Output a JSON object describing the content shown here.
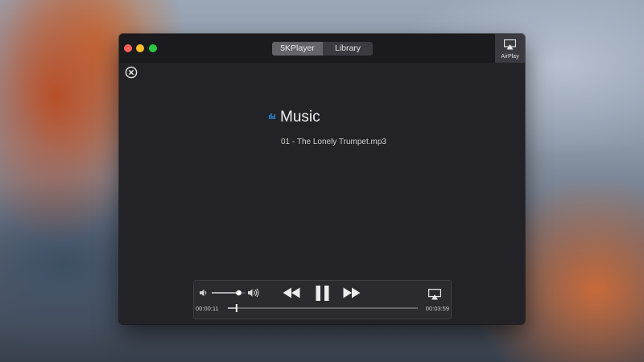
{
  "window": {
    "tabs": [
      {
        "label": "5KPlayer",
        "active": true
      },
      {
        "label": "Library",
        "active": false
      }
    ],
    "airplay_label": "AirPlay"
  },
  "content": {
    "section_title": "Music",
    "tracks": [
      "01 - The Lonely Trumpet.mp3"
    ]
  },
  "player": {
    "elapsed": "00:00:11",
    "duration": "00:03:59",
    "progress_fraction": 0.046,
    "volume_fraction": 0.8,
    "state": "playing"
  },
  "icons": {
    "close": "close-circle-icon",
    "equalizer": "equalizer-icon",
    "volume_low": "speaker-low-icon",
    "volume_high": "speaker-high-icon",
    "rewind": "rewind-icon",
    "pause": "pause-icon",
    "forward": "fast-forward-icon",
    "airplay": "airplay-icon"
  },
  "colors": {
    "accent": "#2f8cdc",
    "window_bg": "#222227",
    "active_tab": "#636369"
  }
}
